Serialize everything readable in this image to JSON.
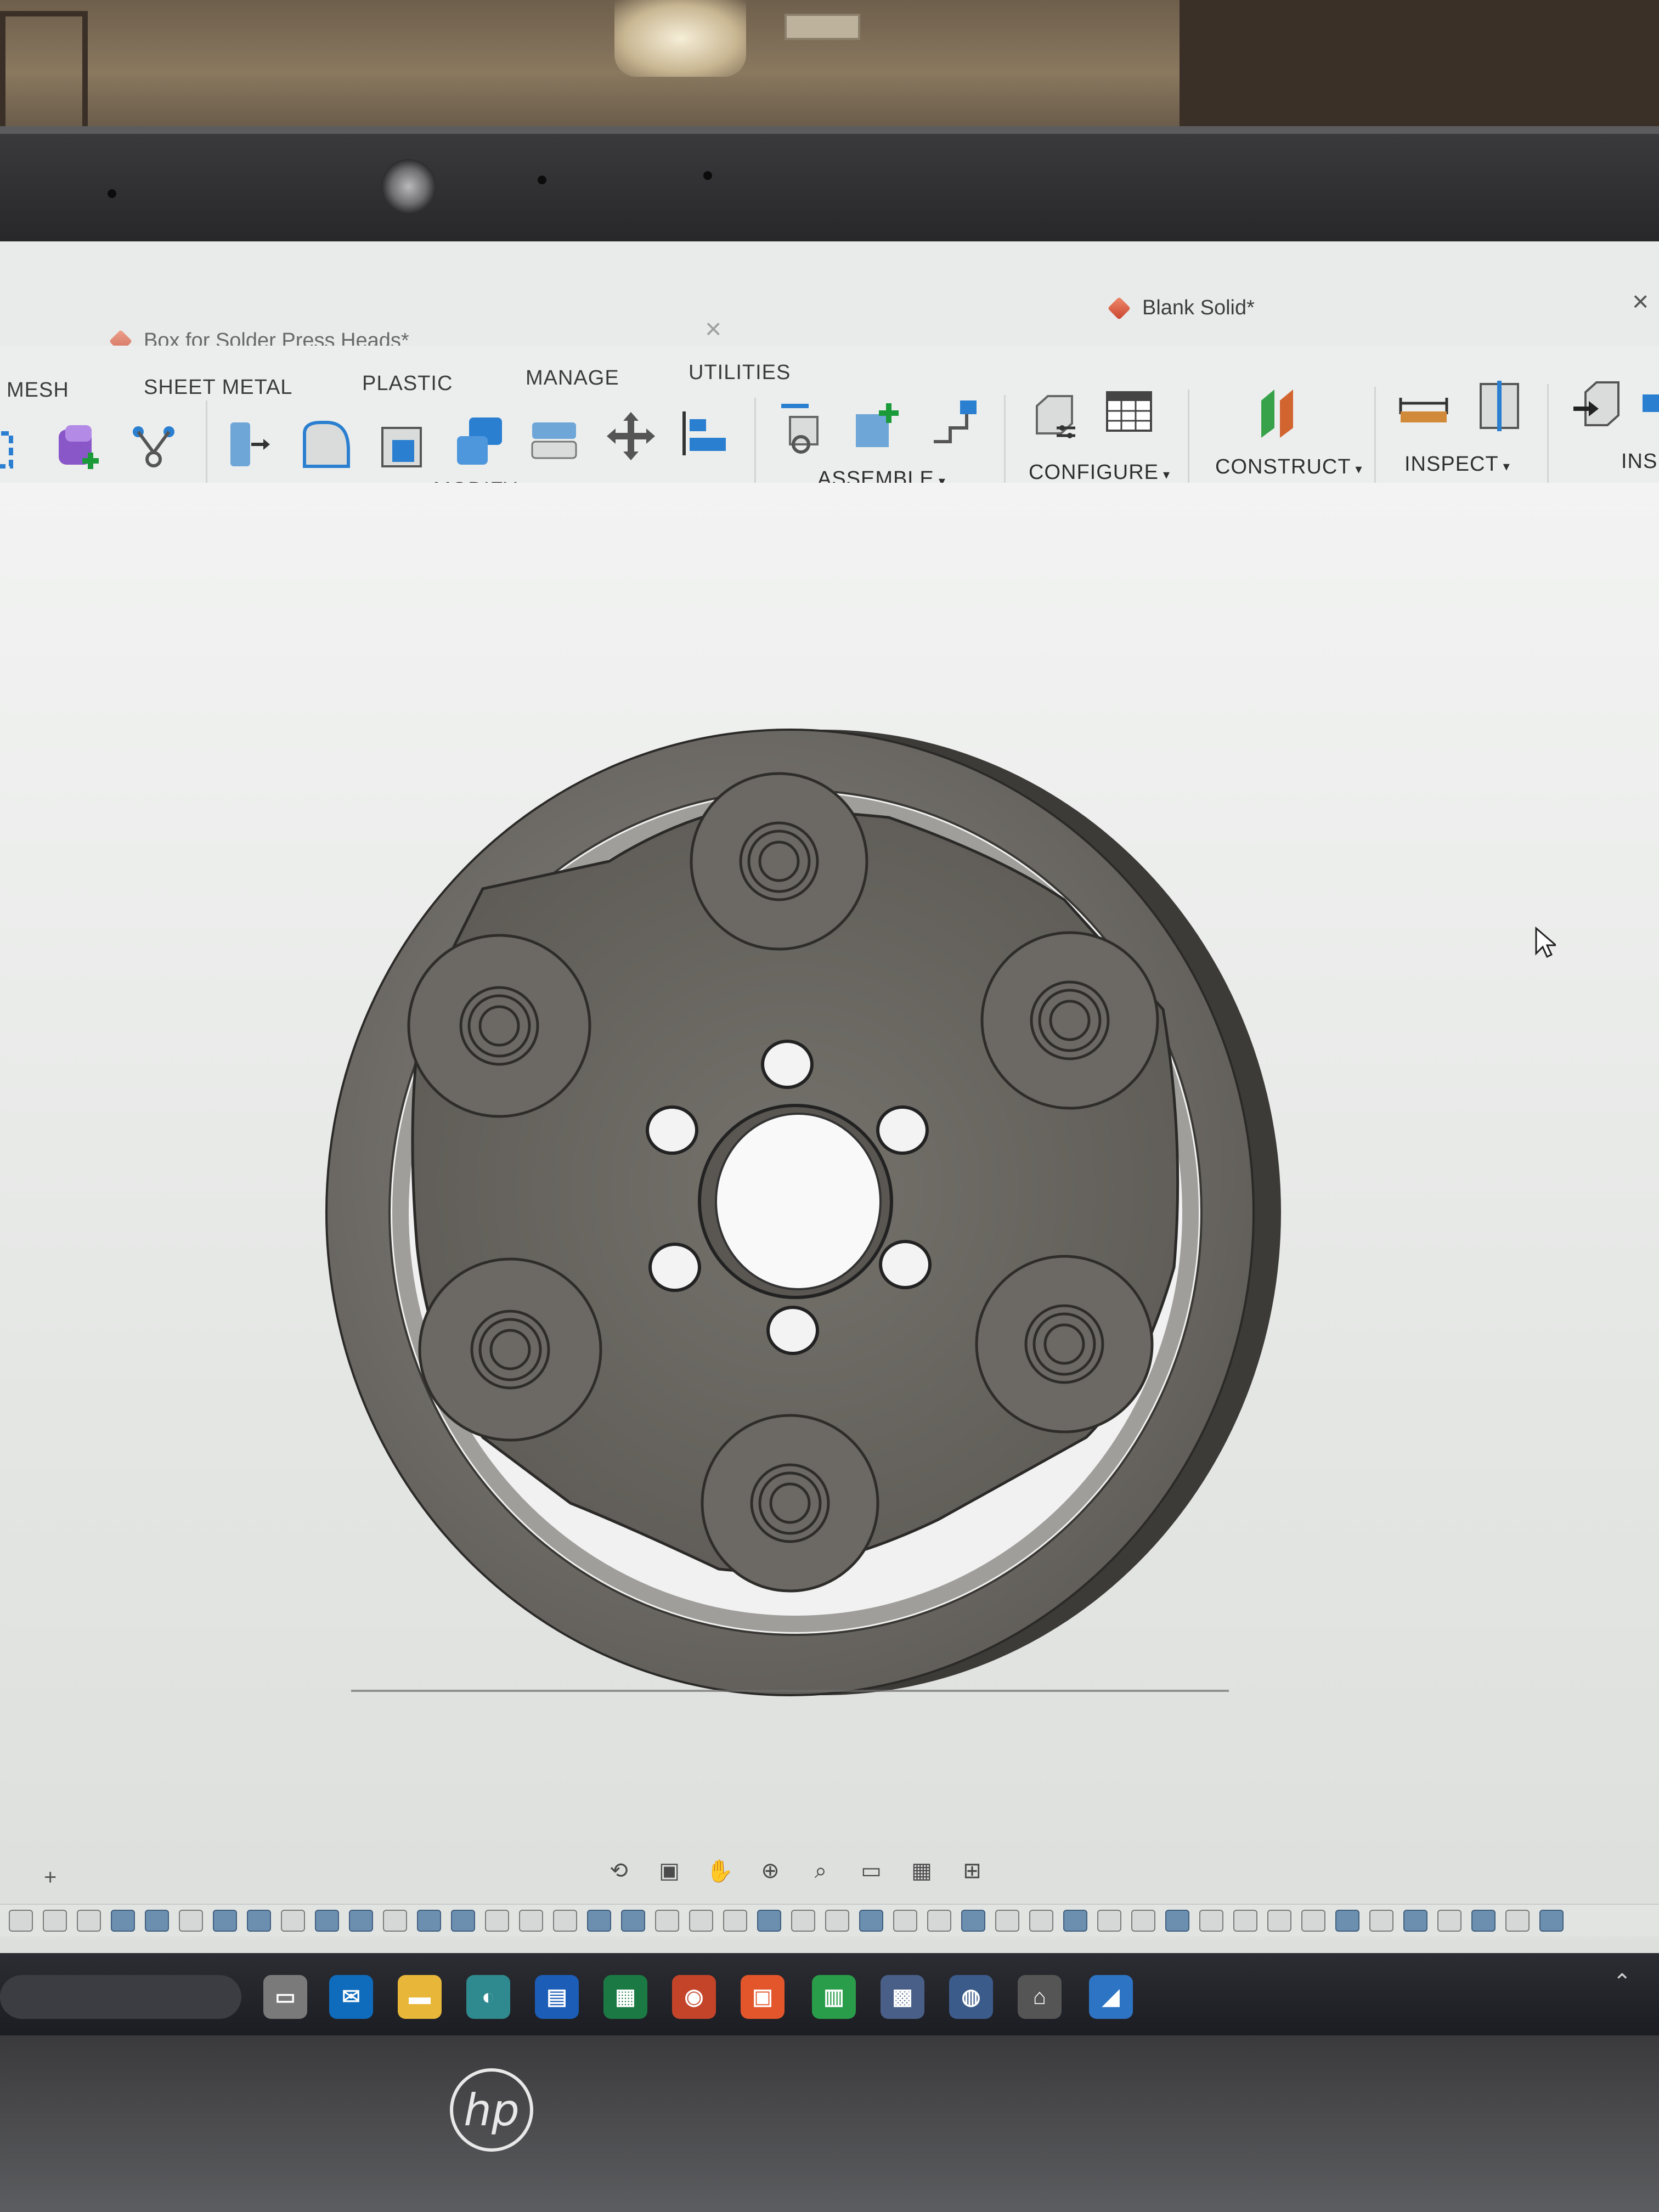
{
  "window": {
    "tab_inactive": "Box for Solder Press Heads*",
    "tab_active": "Blank Solid*"
  },
  "menu": [
    "MESH",
    "SHEET METAL",
    "PLASTIC",
    "MANAGE",
    "UTILITIES"
  ],
  "ribbon_groups": {
    "modify": "MODIFY",
    "assemble": "ASSEMBLE",
    "configure": "CONFIGURE",
    "construct": "CONSTRUCT",
    "inspect": "INSPECT",
    "insert_partial": "INS"
  },
  "dropdown_caret": "▾",
  "canvas": {
    "add_symbol": "+"
  },
  "brand": "hp",
  "colors": {
    "accent": "#2a7fd0",
    "part": "#6b6862",
    "viewport": "#e8eae8"
  }
}
